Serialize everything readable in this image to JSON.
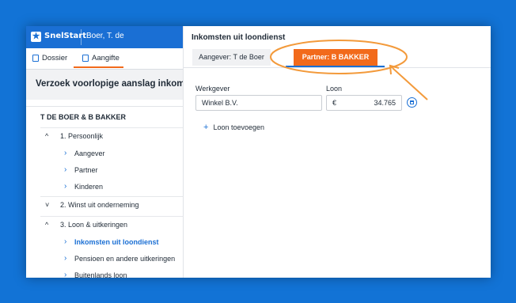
{
  "app": {
    "brand": "SnelStart",
    "dossier": "Boer, T. de"
  },
  "nav": {
    "tabs": [
      {
        "label": "Dossier",
        "icon": "book-icon"
      },
      {
        "label": "Aangifte",
        "icon": "document-icon",
        "active": true
      }
    ]
  },
  "sidebar": {
    "header": "Verzoek voorlopige aanslag inkoms",
    "tree_title": "T DE BOER & B BAKKER",
    "items": [
      {
        "label": "1. Persoonlijk",
        "level": 1,
        "expanded": true
      },
      {
        "label": "Aangever",
        "level": 2
      },
      {
        "label": "Partner",
        "level": 2
      },
      {
        "label": "Kinderen",
        "level": 2
      },
      {
        "label": "2. Winst uit onderneming",
        "level": 1,
        "expanded": false
      },
      {
        "label": "3. Loon & uitkeringen",
        "level": 1,
        "expanded": true
      },
      {
        "label": "Inkomsten uit loondienst",
        "level": 2,
        "active": true
      },
      {
        "label": "Pensioen en andere uitkeringen",
        "level": 2
      },
      {
        "label": "Buitenlands loon",
        "level": 2
      }
    ]
  },
  "main": {
    "title": "Inkomsten uit loondienst",
    "tabs": [
      {
        "label": "Aangever: T de Boer"
      },
      {
        "label": "Partner: B BAKKER",
        "active": true
      }
    ],
    "fields": {
      "werkgever_label": "Werkgever",
      "werkgever_value": "Winkel B.V.",
      "loon_label": "Loon",
      "loon_currency": "€",
      "loon_value": "34.765"
    },
    "add_label": "Loon toevoegen"
  },
  "colors": {
    "brand_blue": "#1a6fd4",
    "accent_orange": "#f26a1b",
    "annotation": "#f39a3b"
  }
}
